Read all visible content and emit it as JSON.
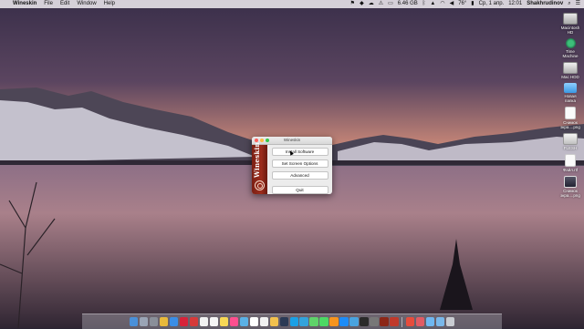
{
  "menubar": {
    "app_name": "Wineskin",
    "menus": [
      "File",
      "Edit",
      "Window",
      "Help"
    ],
    "status": {
      "storage": "6.46 GB",
      "temperature": "76°",
      "date": "Ср, 1 апр.",
      "time": "12:01",
      "user": "Shakhrudinov"
    }
  },
  "desktop_icons": [
    {
      "label": "Macintosh HD",
      "icon": "internal-disk-icon"
    },
    {
      "label": "Time Machine",
      "icon": "time-machine-icon"
    },
    {
      "label": "Mac HDD",
      "icon": "hard-drive-icon"
    },
    {
      "label": "Новая папка",
      "icon": "folder-icon"
    },
    {
      "label": "Снимок экра....png",
      "icon": "image-file-icon"
    },
    {
      "label": "FLESH",
      "icon": "usb-drive-icon"
    },
    {
      "label": "Файл.rtf",
      "icon": "document-file-icon"
    },
    {
      "label": "Снимок экра....png",
      "icon": "image-thumbnail-icon"
    }
  ],
  "window": {
    "title": "Wineskin",
    "brand": "Wineskin",
    "buttons": {
      "install": "Install Software",
      "screen": "Set Screen Options",
      "advanced": "Advanced",
      "quit": "Quit"
    }
  },
  "colors": {
    "brand_red": "#8c2718",
    "close": "#fc605b",
    "minimize": "#fdbc40",
    "zoom": "#34c84a"
  },
  "dock_icons": [
    "finder",
    "launchpad",
    "system-preferences",
    "chrome",
    "safari",
    "opera",
    "vivaldi",
    "reminders",
    "calendar",
    "notes",
    "itunes",
    "preview",
    "calendar-date",
    "textedit",
    "photos",
    "lightroom",
    "skype",
    "telegram",
    "messages",
    "facetime",
    "ibooks",
    "app-store",
    "finder-2",
    "terminal",
    "activity-monitor",
    "wineskin",
    "photo-booth",
    "stack-1",
    "stack-2",
    "downloads",
    "documents",
    "trash"
  ]
}
